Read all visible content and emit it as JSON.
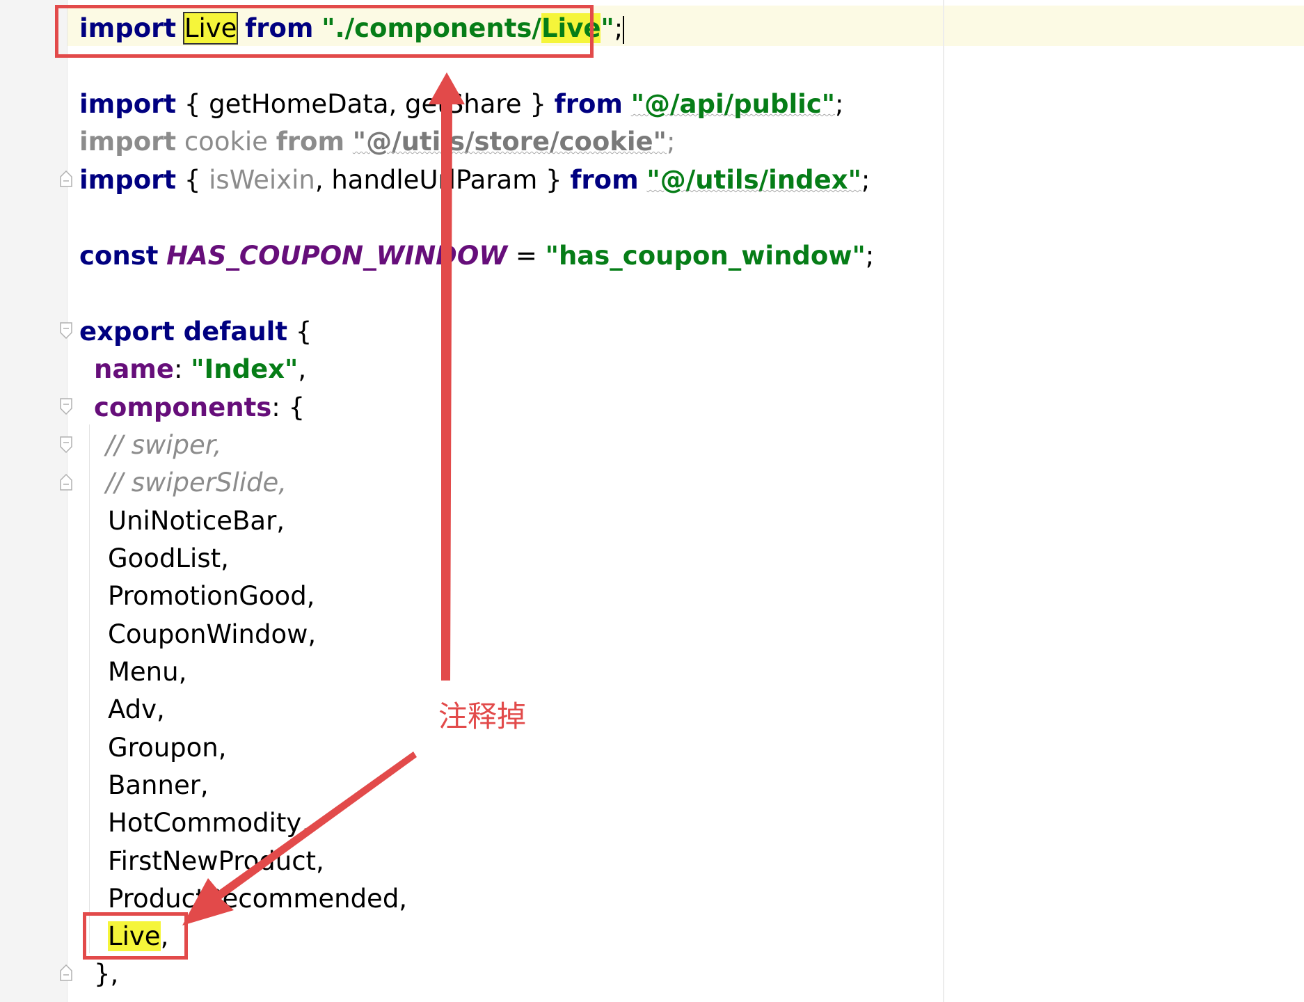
{
  "editor": {
    "lines": {
      "import_live": {
        "kw1": "import",
        "ident": "Live",
        "kw2": "from",
        "q1": "\"",
        "path_prefix": "./components/",
        "path_hl": "Live",
        "q2": "\"",
        "semi": ";"
      },
      "import_api": {
        "kw1": "import",
        "braces": " { getHomeData, getShare } ",
        "kw2": "from",
        "str": "\"@/api/public\"",
        "semi": ";"
      },
      "import_cookie": {
        "kw1": "import",
        "ident": " cookie ",
        "kw2": "from",
        "str": "\"@/utils/store/cookie\"",
        "semi": ";"
      },
      "import_utils": {
        "kw1": "import",
        "open": " { ",
        "dim_ident": "isWeixin",
        "rest": ", handleUrlParam } ",
        "kw2": "from",
        "str": "\"@/utils/index\"",
        "semi": ";"
      },
      "const_line": {
        "kw": "const",
        "space": " ",
        "name": "HAS_COUPON_WINDOW",
        "eq": " = ",
        "str": "\"has_coupon_window\"",
        "semi": ";"
      },
      "export_line": {
        "kw": "export default",
        "brace": " {"
      },
      "name_line": {
        "prop": "name",
        "colon": ": ",
        "str": "\"Index\"",
        "comma": ","
      },
      "components_line": {
        "prop": "components",
        "rest": ": {"
      },
      "comment1": "// swiper,",
      "comment2": "// swiperSlide,",
      "items": [
        "UniNoticeBar,",
        "GoodList,",
        "PromotionGood,",
        "CouponWindow,",
        "Menu,",
        "Adv,",
        "Groupon,",
        "Banner,",
        "HotCommodity,",
        "FirstNewProduct,",
        "ProductRecommended,"
      ],
      "live_item": {
        "name": "Live",
        "comma": ","
      },
      "close_line": "},"
    }
  },
  "annotation": {
    "text": "注释掉",
    "color": "#e24a4a"
  }
}
